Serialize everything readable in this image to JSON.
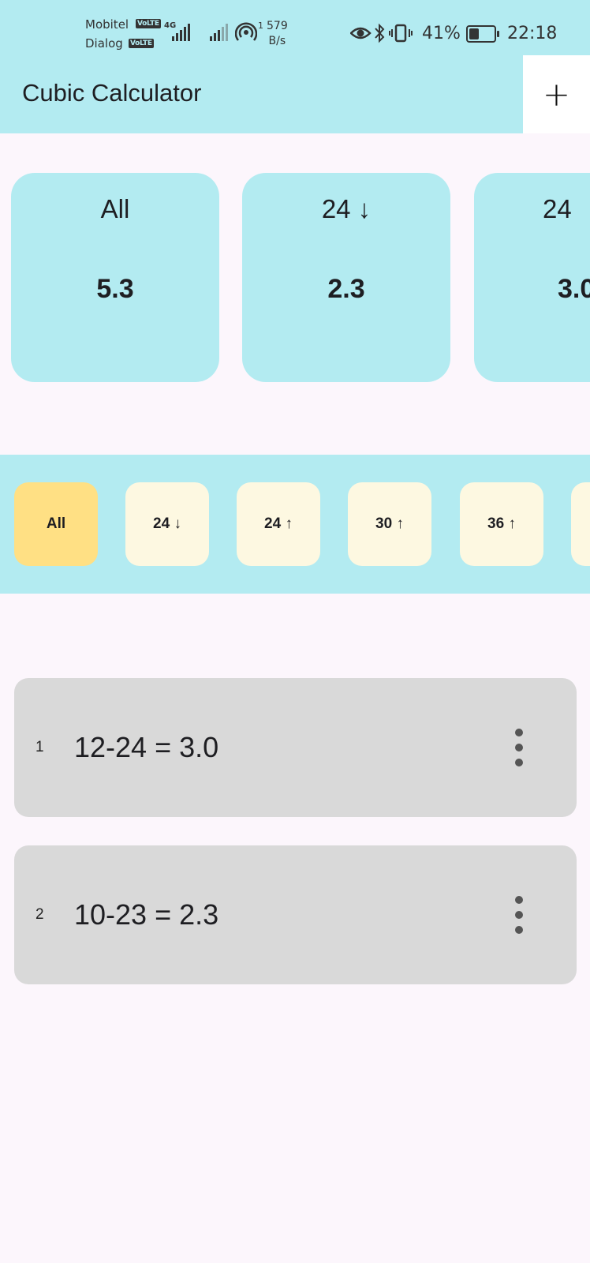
{
  "status_bar": {
    "carrier1": "Mobitel",
    "carrier2": "Dialog",
    "volte": "VoLTE",
    "network": "4G",
    "hotspot_count": "1",
    "speed_value": "579",
    "speed_unit": "B/s",
    "battery": "41%",
    "battery_level": 0.41,
    "time": "22:18"
  },
  "app_bar": {
    "title": "Cubic Calculator",
    "add_label": "+"
  },
  "summary_cards": [
    {
      "label": "All",
      "value": "5.3"
    },
    {
      "label": "24 ↓",
      "value": "2.3"
    },
    {
      "label": "24",
      "value": "3.0"
    }
  ],
  "filters": [
    {
      "label": "All",
      "active": true
    },
    {
      "label": "24 ↓",
      "active": false
    },
    {
      "label": "24 ↑",
      "active": false
    },
    {
      "label": "30 ↑",
      "active": false
    },
    {
      "label": "36 ↑",
      "active": false
    },
    {
      "label": "",
      "active": false
    }
  ],
  "results": [
    {
      "index": "1",
      "text": "12-24 = 3.0"
    },
    {
      "index": "2",
      "text": "10-23 = 2.3"
    }
  ],
  "colors": {
    "accent_cyan": "#b3ebf1",
    "active_chip": "#ffe084",
    "chip": "#fdf8e1",
    "list_item": "#d9d9d9",
    "background": "#fcf6fc"
  }
}
